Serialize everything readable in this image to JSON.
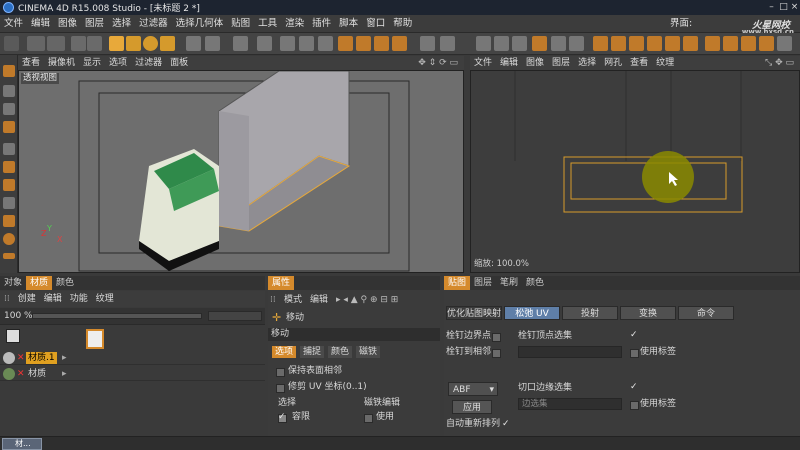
{
  "window": {
    "title": "CINEMA 4D R15.008 Studio - [未标题 2 *]"
  },
  "menu": [
    "文件",
    "编辑",
    "图像",
    "图层",
    "选择",
    "过滤器",
    "选择几何体",
    "贴图",
    "工具",
    "渲染",
    "插件",
    "脚本",
    "窗口",
    "帮助"
  ],
  "menu_right": {
    "layout_label": "界面:"
  },
  "logo": {
    "text": "火星网校",
    "url": "www.hxsd.cn"
  },
  "viewport": {
    "menu": [
      "查看",
      "摄像机",
      "显示",
      "选项",
      "过滤器",
      "面板"
    ],
    "label": "透视视图"
  },
  "uv_editor": {
    "menu": [
      "文件",
      "编辑",
      "图像",
      "图层",
      "选择",
      "网孔",
      "查看",
      "纹理"
    ],
    "zoom": "缩放: 100.0%"
  },
  "objects_panel": {
    "tabs": [
      "对象",
      "材质",
      "颜色"
    ],
    "active_tab": "材质",
    "menu": [
      "创建",
      "编辑",
      "功能",
      "纹理"
    ],
    "zoom": "100 %",
    "materials": [
      {
        "name": "材质.1"
      },
      {
        "name": "材质"
      }
    ]
  },
  "attributes": {
    "tab": "属性",
    "menu": [
      "模式",
      "编辑"
    ],
    "tool_name": "移动",
    "section": "移动",
    "subtabs": [
      "选项",
      "捕捉",
      "颜色",
      "磁铁"
    ],
    "options": [
      {
        "label": "保持表面相邻"
      },
      {
        "label": "修剪 UV 坐标(0..1)"
      }
    ],
    "group_select": "选择",
    "group_magnet": "磁铁编辑",
    "item_contain": "容限",
    "item_use": "使用"
  },
  "uv_tools": {
    "tabs": [
      "贴图",
      "图层",
      "笔刷",
      "颜色"
    ],
    "subtabs": [
      "优化贴图映射",
      "松弛 UV",
      "投射",
      "变换",
      "命令"
    ],
    "active_subtab": "松弛 UV",
    "pin_border": "栓钉边界点",
    "pin_neighbors": "栓钉到相邻",
    "pin_vertex_sel": "栓钉顶点选集",
    "use_tags_1": "使用标签",
    "method": "ABF",
    "apply": "应用",
    "cut_edge_sel": "切口边缘选集",
    "edge_sel_placeholder": "边选集",
    "use_tags_2": "使用标签",
    "auto_realign": "自动重新排列"
  },
  "status": {
    "mini_window": "材..."
  }
}
